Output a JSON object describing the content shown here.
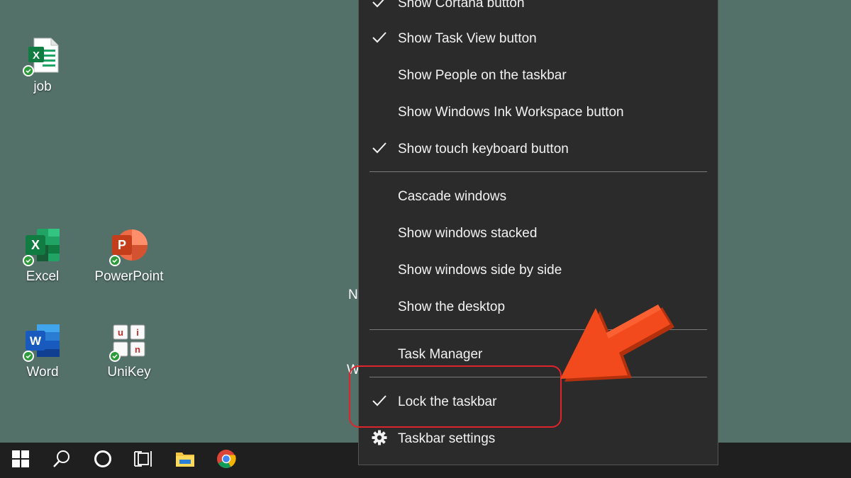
{
  "desktop": {
    "icons": [
      {
        "label": "job",
        "icon": "excel-file-icon"
      },
      {
        "label": "Excel",
        "icon": "excel-app-icon"
      },
      {
        "label": "PowerPoint",
        "icon": "powerpoint-app-icon"
      },
      {
        "label": "Word",
        "icon": "word-app-icon"
      },
      {
        "label": "UniKey",
        "icon": "unikey-app-icon"
      }
    ],
    "partial_texts": [
      "N",
      "W"
    ]
  },
  "context_menu": {
    "items": [
      {
        "label": "Show Cortana button",
        "checked": true
      },
      {
        "label": "Show Task View button",
        "checked": true
      },
      {
        "label": "Show People on the taskbar",
        "checked": false
      },
      {
        "label": "Show Windows Ink Workspace button",
        "checked": false
      },
      {
        "label": "Show touch keyboard button",
        "checked": true
      },
      {
        "label": "Cascade windows",
        "checked": false
      },
      {
        "label": "Show windows stacked",
        "checked": false
      },
      {
        "label": "Show windows side by side",
        "checked": false
      },
      {
        "label": "Show the desktop",
        "checked": false
      },
      {
        "label": "Task Manager",
        "checked": false
      },
      {
        "label": "Lock the taskbar",
        "checked": true
      },
      {
        "label": "Taskbar settings",
        "checked": false,
        "icon": "gear-icon"
      }
    ]
  },
  "taskbar": {
    "buttons": [
      "windows-start-icon",
      "search-icon",
      "cortana-icon",
      "task-view-icon",
      "file-explorer-icon",
      "chrome-icon"
    ]
  },
  "colors": {
    "desktop_bg": "#537169",
    "menu_bg": "#2b2b2b",
    "taskbar_bg": "#1f1f1f",
    "highlight": "#e0242c",
    "arrow": "#f24a1c"
  }
}
